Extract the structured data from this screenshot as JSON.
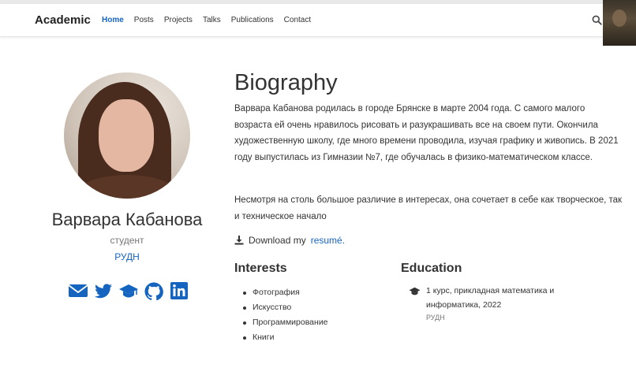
{
  "navbar": {
    "brand": "Academic",
    "items": [
      {
        "label": "Home",
        "active": true
      },
      {
        "label": "Posts",
        "active": false
      },
      {
        "label": "Projects",
        "active": false
      },
      {
        "label": "Talks",
        "active": false
      },
      {
        "label": "Publications",
        "active": false
      },
      {
        "label": "Contact",
        "active": false
      }
    ],
    "search_icon": "search-icon"
  },
  "profile": {
    "name": "Варвара Кабанова",
    "role": "студент",
    "organization": "РУДН",
    "socials": [
      "envelope-icon",
      "twitter-icon",
      "graduation-cap-icon",
      "github-icon",
      "linkedin-icon"
    ]
  },
  "biography": {
    "title": "Biography",
    "paragraph1": "Варвара Кабанова родилась в городе Брянске в марте 2004 года. С самого малого возраста ей очень нравилось рисовать и разукрашивать все на своем пути. Окончила художественную школу, где много времени проводила, изучая графику и живопись. В 2021 году выпустилась из Гимназии №7, где обучалась в физико-математическом классе.",
    "paragraph2": "Несмотря на столь большое различие в интересах, она сочетает в себе как творческое, так и техническое начало",
    "download_prefix": "Download my",
    "download_link": "resumé."
  },
  "interests": {
    "title": "Interests",
    "items": [
      "Фотография",
      "Искусство",
      "Программирование",
      "Книги"
    ]
  },
  "education": {
    "title": "Education",
    "course": "1 курс, прикладная математика и информатика, 2022",
    "institution": "РУДН"
  },
  "colors": {
    "accent": "#1565c0",
    "text": "#333333",
    "muted": "#777777"
  }
}
